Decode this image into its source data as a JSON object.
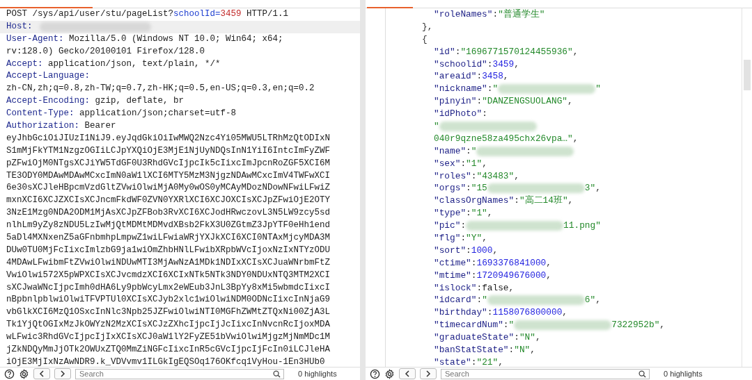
{
  "request": {
    "lines": [
      {
        "highlighted": false,
        "segments": [
          {
            "kind": "plain",
            "text": "POST /sys/api/user/stu/pageList?"
          },
          {
            "kind": "param-name",
            "text": "schoolId="
          },
          {
            "kind": "param-value",
            "text": "3459"
          },
          {
            "kind": "plain",
            "text": " HTTP/1.1"
          }
        ]
      },
      {
        "highlighted": true,
        "segments": [
          {
            "kind": "header-name",
            "text": "Host:"
          },
          {
            "kind": "redacted"
          }
        ]
      },
      {
        "highlighted": false,
        "segments": [
          {
            "kind": "header-name",
            "text": "User-Agent:"
          },
          {
            "kind": "plain",
            "text": " Mozilla/5.0 (Windows NT 10.0; Win64; x64;"
          }
        ]
      },
      {
        "highlighted": false,
        "segments": [
          {
            "kind": "plain",
            "text": "rv:128.0) Gecko/20100101 Firefox/128.0"
          }
        ]
      },
      {
        "highlighted": false,
        "segments": [
          {
            "kind": "header-name",
            "text": "Accept:"
          },
          {
            "kind": "plain",
            "text": " application/json, text/plain, */*"
          }
        ]
      },
      {
        "highlighted": false,
        "segments": [
          {
            "kind": "header-name",
            "text": "Accept-Language:"
          }
        ]
      },
      {
        "highlighted": false,
        "segments": [
          {
            "kind": "plain",
            "text": "zh-CN,zh;q=0.8,zh-TW;q=0.7,zh-HK;q=0.5,en-US;q=0.3,en;q=0.2"
          }
        ]
      },
      {
        "highlighted": false,
        "segments": [
          {
            "kind": "header-name",
            "text": "Accept-Encoding:"
          },
          {
            "kind": "plain",
            "text": " gzip, deflate, br"
          }
        ]
      },
      {
        "highlighted": false,
        "segments": [
          {
            "kind": "header-name",
            "text": "Content-Type:"
          },
          {
            "kind": "plain",
            "text": " application/json;charset=utf-8"
          }
        ]
      },
      {
        "highlighted": false,
        "segments": [
          {
            "kind": "header-name",
            "text": "Authorization:"
          },
          {
            "kind": "plain",
            "text": " Bearer"
          }
        ]
      },
      {
        "highlighted": false,
        "segments": [
          {
            "kind": "plain",
            "text": "eyJhbGciOiJIUzI1NiJ9.eyJqdGkiOiIwMWQ2Nzc4Yi05MWU5LTRhMzQtODIxN"
          }
        ]
      },
      {
        "highlighted": false,
        "segments": [
          {
            "kind": "plain",
            "text": "S1mMjFkYTM1NzgzOGIiLCJpYXQiOjE3MjE1NjUyNDQsInN1YiI6IntcImFyZWF"
          }
        ]
      },
      {
        "highlighted": false,
        "segments": [
          {
            "kind": "plain",
            "text": "pZFwiOjM0NTgsXCJiYW5TdGF0U3RhdGVcIjpcIk5cIixcImJpcnRoZGF5XCI6M"
          }
        ]
      },
      {
        "highlighted": false,
        "segments": [
          {
            "kind": "plain",
            "text": "TE3ODY0MDAwMDAwMCxcImN0aW1lXCI6MTY5MzM3NjgzNDAwMCxcImV4TWFwXCI"
          }
        ]
      },
      {
        "highlighted": false,
        "segments": [
          {
            "kind": "plain",
            "text": "6e30sXCJleHBpcmVzdGltZVwiOlwiMjA0My0wOS0yMCAyMDozNDowNFwiLFwiZ"
          }
        ]
      },
      {
        "highlighted": false,
        "segments": [
          {
            "kind": "plain",
            "text": "mxnXCI6XCJZXCIsXCJncmFkdWF0ZVN0YXRlXCI6XCJOXCIsXCJpZFwiOjE2OTY"
          }
        ]
      },
      {
        "highlighted": false,
        "segments": [
          {
            "kind": "plain",
            "text": "3NzE1Mzg0NDA2ODM1MjAsXCJpZFBob3RvXCI6XCJodHRwczovL3N5LW9zcy5sd"
          }
        ]
      },
      {
        "highlighted": false,
        "segments": [
          {
            "kind": "plain",
            "text": "nlhLm9yZy8zNDU5LzIwMjQtMDMtMDMvdXBsb2FkX3U0ZGtmZ3JpYTF0eHh1end"
          }
        ]
      },
      {
        "highlighted": false,
        "segments": [
          {
            "kind": "plain",
            "text": "5aDl4MXNxenZ5aGFnbmhpLmpwZ1wiLFwiaWRjYXJkXCI6XCI0NTAxMjcyMDA3M"
          }
        ]
      },
      {
        "highlighted": false,
        "segments": [
          {
            "kind": "plain",
            "text": "DUw0TU0MjFcIixcImlzbG9ja1wiOmZhbHNlLFwibXRpbWVcIjoxNzIxNTYzODU"
          }
        ]
      },
      {
        "highlighted": false,
        "segments": [
          {
            "kind": "plain",
            "text": "4MDAwLFwibmFtZVwiOlwiNDUwMTI3MjAwNzA1MDk1NDIxXCIsXCJuaWNrbmFtZ"
          }
        ]
      },
      {
        "highlighted": false,
        "segments": [
          {
            "kind": "plain",
            "text": "VwiOlwi572X5pWPXCIsXCJvcmdzXCI6XCIxNTk5NTk3NDY0NDUxNTQ3MTM2XCI"
          }
        ]
      },
      {
        "highlighted": false,
        "segments": [
          {
            "kind": "plain",
            "text": "sXCJwaWNcIjpcImh0dHA6Ly9pbWcyLmx2eWEub3JnL3BpYy8xMi5wbmdcIixcI"
          }
        ]
      },
      {
        "highlighted": false,
        "segments": [
          {
            "kind": "plain",
            "text": "nBpbnlpblwiOlwiTFVPTUl0XCIsXCJyb2xlc1wiOlwiNDM0ODNcIixcInNjaG9"
          }
        ]
      },
      {
        "highlighted": false,
        "segments": [
          {
            "kind": "plain",
            "text": "vbGlkXCI6MzQ1OSxcInNlc3Npb25JZFwiOlwiNTI0MGFhZWMtZTQxNi00ZjA3L"
          }
        ]
      },
      {
        "highlighted": false,
        "segments": [
          {
            "kind": "plain",
            "text": "Tk1YjQtOGIxMzJkOWYzN2MzXCIsXCJzZXhcIjpcIjJcIixcInNvcnRcIjoxMDA"
          }
        ]
      },
      {
        "highlighted": false,
        "segments": [
          {
            "kind": "plain",
            "text": "wLFwic3RhdGVcIjpcIjIxXCIsXCJ0aW1lY2FyZE51bVwiOlwiMjgzMjNmMDc1M"
          }
        ]
      },
      {
        "highlighted": false,
        "segments": [
          {
            "kind": "plain",
            "text": "jZkNDQyMmJjOTk2OWUxZTQ0MmZiNGFcIixcInR5cGVcIjpcIjFcIn0iLCJleHA"
          }
        ]
      },
      {
        "highlighted": false,
        "segments": [
          {
            "kind": "plain",
            "text": "iOjE3MjIxNzAwNDR9.k_VDVvmv1ILGkIgEQSOq176OKfcq1VyHou-1En3HUb0"
          }
        ]
      }
    ]
  },
  "response": {
    "lines": [
      {
        "children": [
          {
            "segments": [
              {
                "kind": "key",
                "text": "\"roleNames\""
              },
              {
                "kind": "punct",
                "text": ":"
              },
              {
                "kind": "string",
                "text": "\"普通学生\""
              }
            ]
          }
        ]
      },
      {
        "segments": [
          {
            "kind": "punct",
            "text": "},"
          }
        ]
      },
      {
        "segments": [
          {
            "kind": "punct",
            "text": "{"
          }
        ]
      },
      {
        "children": [
          {
            "segments": [
              {
                "kind": "key",
                "text": "\"id\""
              },
              {
                "kind": "punct",
                "text": ":"
              },
              {
                "kind": "string",
                "text": "\"1696771570124455936\""
              },
              {
                "kind": "punct",
                "text": ","
              }
            ]
          },
          {
            "segments": [
              {
                "kind": "key",
                "text": "\"schoolid\""
              },
              {
                "kind": "punct",
                "text": ":"
              },
              {
                "kind": "number",
                "text": "3459"
              },
              {
                "kind": "punct",
                "text": ","
              }
            ]
          },
          {
            "segments": [
              {
                "kind": "key",
                "text": "\"areaid\""
              },
              {
                "kind": "punct",
                "text": ":"
              },
              {
                "kind": "number",
                "text": "3458"
              },
              {
                "kind": "punct",
                "text": ","
              }
            ]
          },
          {
            "segments": [
              {
                "kind": "key",
                "text": "\"nickname\""
              },
              {
                "kind": "punct",
                "text": ":"
              },
              {
                "kind": "string",
                "text": "\""
              },
              {
                "kind": "redacted"
              },
              {
                "kind": "string",
                "text": "\""
              }
            ]
          },
          {
            "segments": [
              {
                "kind": "key",
                "text": "\"pinyin\""
              },
              {
                "kind": "punct",
                "text": ":"
              },
              {
                "kind": "string",
                "text": "\"DANZENGSUOLANG\""
              },
              {
                "kind": "punct",
                "text": ","
              }
            ]
          },
          {
            "segments": [
              {
                "kind": "key",
                "text": "\"idPhoto\""
              },
              {
                "kind": "punct",
                "text": ":"
              }
            ]
          },
          {
            "segments": [
              {
                "kind": "string",
                "text": "\""
              },
              {
                "kind": "redacted"
              }
            ]
          },
          {
            "segments": [
              {
                "kind": "string",
                "text": "040r9qzne58za495chx26vpa…\""
              },
              {
                "kind": "punct",
                "text": ","
              }
            ]
          },
          {
            "segments": [
              {
                "kind": "key",
                "text": "\"name\""
              },
              {
                "kind": "punct",
                "text": ":"
              },
              {
                "kind": "string",
                "text": "\""
              },
              {
                "kind": "redacted"
              }
            ]
          },
          {
            "segments": [
              {
                "kind": "key",
                "text": "\"sex\""
              },
              {
                "kind": "punct",
                "text": ":"
              },
              {
                "kind": "string",
                "text": "\"1\""
              },
              {
                "kind": "punct",
                "text": ","
              }
            ]
          },
          {
            "segments": [
              {
                "kind": "key",
                "text": "\"roles\""
              },
              {
                "kind": "punct",
                "text": ":"
              },
              {
                "kind": "string",
                "text": "\"43483\""
              },
              {
                "kind": "punct",
                "text": ","
              }
            ]
          },
          {
            "segments": [
              {
                "kind": "key",
                "text": "\"orgs\""
              },
              {
                "kind": "punct",
                "text": ":"
              },
              {
                "kind": "string",
                "text": "\"15"
              },
              {
                "kind": "redacted"
              },
              {
                "kind": "string",
                "text": "3\""
              },
              {
                "kind": "punct",
                "text": ","
              }
            ]
          },
          {
            "segments": [
              {
                "kind": "key",
                "text": "\"classOrgNames\""
              },
              {
                "kind": "punct",
                "text": ":"
              },
              {
                "kind": "string",
                "text": "\"高二14班\""
              },
              {
                "kind": "punct",
                "text": ","
              }
            ]
          },
          {
            "segments": [
              {
                "kind": "key",
                "text": "\"type\""
              },
              {
                "kind": "punct",
                "text": ":"
              },
              {
                "kind": "string",
                "text": "\"1\""
              },
              {
                "kind": "punct",
                "text": ","
              }
            ]
          },
          {
            "segments": [
              {
                "kind": "key",
                "text": "\"pic\""
              },
              {
                "kind": "punct",
                "text": ":"
              },
              {
                "kind": "redacted"
              },
              {
                "kind": "string",
                "text": "11.png\""
              }
            ]
          },
          {
            "segments": [
              {
                "kind": "key",
                "text": "\"flg\""
              },
              {
                "kind": "punct",
                "text": ":"
              },
              {
                "kind": "string",
                "text": "\"Y\""
              },
              {
                "kind": "punct",
                "text": ","
              }
            ]
          },
          {
            "segments": [
              {
                "kind": "key",
                "text": "\"sort\""
              },
              {
                "kind": "punct",
                "text": ":"
              },
              {
                "kind": "number",
                "text": "1000"
              },
              {
                "kind": "punct",
                "text": ","
              }
            ]
          },
          {
            "segments": [
              {
                "kind": "key",
                "text": "\"ctime\""
              },
              {
                "kind": "punct",
                "text": ":"
              },
              {
                "kind": "number",
                "text": "1693376841000"
              },
              {
                "kind": "punct",
                "text": ","
              }
            ]
          },
          {
            "segments": [
              {
                "kind": "key",
                "text": "\"mtime\""
              },
              {
                "kind": "punct",
                "text": ":"
              },
              {
                "kind": "number",
                "text": "1720949676000"
              },
              {
                "kind": "punct",
                "text": ","
              }
            ]
          },
          {
            "segments": [
              {
                "kind": "key",
                "text": "\"islock\""
              },
              {
                "kind": "punct",
                "text": ":"
              },
              {
                "kind": "literal",
                "text": "false"
              },
              {
                "kind": "punct",
                "text": ","
              }
            ]
          },
          {
            "segments": [
              {
                "kind": "key",
                "text": "\"idcard\""
              },
              {
                "kind": "punct",
                "text": ":"
              },
              {
                "kind": "string",
                "text": "\""
              },
              {
                "kind": "redacted"
              },
              {
                "kind": "string",
                "text": "6\""
              },
              {
                "kind": "punct",
                "text": ","
              }
            ]
          },
          {
            "segments": [
              {
                "kind": "key",
                "text": "\"birthday\""
              },
              {
                "kind": "punct",
                "text": ":"
              },
              {
                "kind": "number",
                "text": "1158076800000"
              },
              {
                "kind": "punct",
                "text": ","
              }
            ]
          },
          {
            "segments": [
              {
                "kind": "key",
                "text": "\"timecardNum\""
              },
              {
                "kind": "punct",
                "text": ":"
              },
              {
                "kind": "string",
                "text": "\""
              },
              {
                "kind": "redacted"
              },
              {
                "kind": "string",
                "text": "7322952b\""
              },
              {
                "kind": "punct",
                "text": ","
              }
            ]
          },
          {
            "segments": [
              {
                "kind": "key",
                "text": "\"graduateState\""
              },
              {
                "kind": "punct",
                "text": ":"
              },
              {
                "kind": "string",
                "text": "\"N\""
              },
              {
                "kind": "punct",
                "text": ","
              }
            ]
          },
          {
            "segments": [
              {
                "kind": "key",
                "text": "\"banStatState\""
              },
              {
                "kind": "punct",
                "text": ":"
              },
              {
                "kind": "string",
                "text": "\"N\""
              },
              {
                "kind": "punct",
                "text": ","
              }
            ]
          },
          {
            "segments": [
              {
                "kind": "key",
                "text": "\"state\""
              },
              {
                "kind": "punct",
                "text": ":"
              },
              {
                "kind": "string",
                "text": "\"21\""
              },
              {
                "kind": "punct",
                "text": ","
              }
            ]
          }
        ]
      }
    ]
  },
  "toolbars": [
    {
      "search_placeholder": "Search",
      "highlights": "0 highlights"
    },
    {
      "search_placeholder": "Search",
      "highlights": "0 highlights"
    }
  ]
}
